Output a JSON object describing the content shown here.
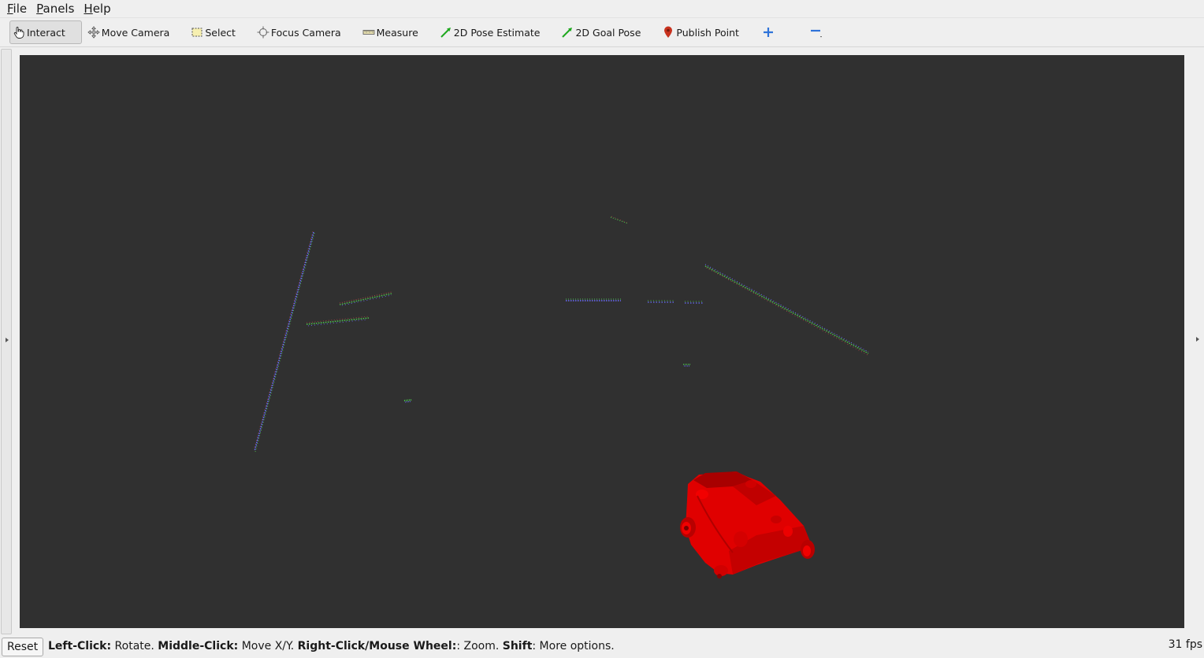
{
  "menu": {
    "items": [
      {
        "mnemonic": "F",
        "rest": "ile"
      },
      {
        "mnemonic": "P",
        "rest": "anels"
      },
      {
        "mnemonic": "H",
        "rest": "elp"
      }
    ]
  },
  "toolbar": {
    "interact": "Interact",
    "move_camera": "Move Camera",
    "select": "Select",
    "focus_camera": "Focus Camera",
    "measure": "Measure",
    "pose_estimate": "2D Pose Estimate",
    "goal_pose": "2D Goal Pose",
    "publish_point": "Publish Point",
    "icons": {
      "interact": "hand-pointer-icon",
      "move_camera": "move-arrows-icon",
      "select": "selection-rect-icon",
      "focus_camera": "focus-crosshair-icon",
      "measure": "ruler-icon",
      "pose_estimate": "green-arrow-icon",
      "goal_pose": "green-arrow-icon",
      "publish_point": "map-pin-icon",
      "add_tool": "plus-icon",
      "remove_tool": "minus-icon"
    }
  },
  "colors": {
    "viewport_bg": "#303030",
    "robot": "#e00000",
    "laser_green": "#4cc04c",
    "laser_blue": "#6a6aff",
    "laser_red": "#d04a4a"
  },
  "status": {
    "reset": "Reset",
    "hint_parts": [
      {
        "bold": "Left-Click:",
        "text": " Rotate. "
      },
      {
        "bold": "Middle-Click:",
        "text": " Move X/Y. "
      },
      {
        "bold": "Right-Click/Mouse Wheel:",
        "text": ": Zoom. "
      },
      {
        "bold": "Shift",
        "text": ": More options."
      }
    ],
    "fps": "31 fps"
  }
}
